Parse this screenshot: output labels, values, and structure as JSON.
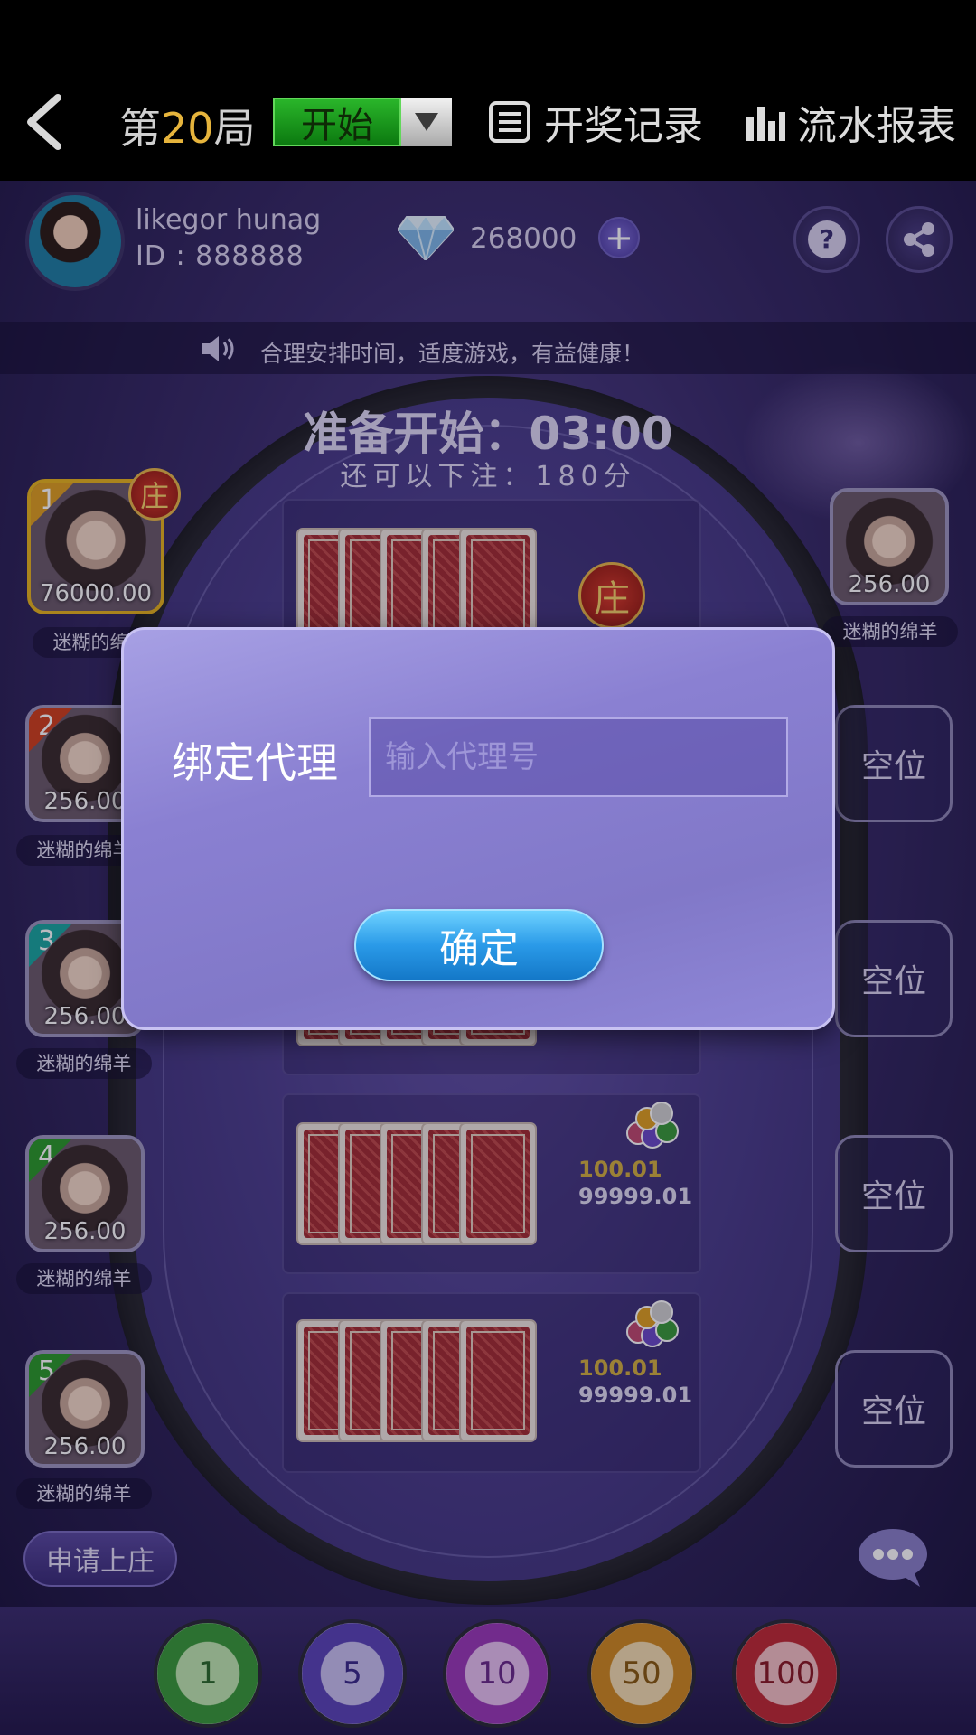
{
  "nav": {
    "round_prefix": "第",
    "round_number": "20",
    "round_suffix": "局",
    "start_label": "开始",
    "records_label": "开奖记录",
    "report_label": "流水报表"
  },
  "user": {
    "name": "likegor hunag",
    "id": "ID : 888888",
    "diamonds": "268000"
  },
  "notice": "合理安排时间，适度游戏，有益健康！",
  "table": {
    "countdown": "准备开始：03:00",
    "bet_remaining": "还可以下注：180分",
    "banker_label": "庄",
    "hands": [
      {
        "bet_a": "100.01",
        "bet_b": "99999.01"
      },
      {
        "bet_a": "100.01",
        "bet_b": "99999.01"
      }
    ]
  },
  "left_seats": [
    {
      "num": "1",
      "score": "76000.00",
      "name": "迷糊的绵羊",
      "color": "#e0a020"
    },
    {
      "num": "2",
      "score": "256.00",
      "name": "迷糊的绵羊",
      "color": "#d0401c"
    },
    {
      "num": "3",
      "score": "256.00",
      "name": "迷糊的绵羊",
      "color": "#1aa7a0"
    },
    {
      "num": "4",
      "score": "256.00",
      "name": "迷糊的绵羊",
      "color": "#2b9a2a"
    },
    {
      "num": "5",
      "score": "256.00",
      "name": "迷糊的绵羊",
      "color": "#2b9a2a"
    }
  ],
  "right_seat": {
    "score": "256.00",
    "name": "迷糊的绵羊"
  },
  "empty_seat_label": "空位",
  "apply_banker": "申请上庄",
  "chips": [
    {
      "value": "1",
      "color": "#3a9a3a"
    },
    {
      "value": "5",
      "color": "#5a44b8"
    },
    {
      "value": "10",
      "color": "#9a3ab8"
    },
    {
      "value": "50",
      "color": "#d08a20"
    },
    {
      "value": "100",
      "color": "#c02a34"
    }
  ],
  "dialog": {
    "label": "绑定代理",
    "placeholder": "输入代理号",
    "confirm": "确定"
  },
  "icons": {
    "back": "chevron-left-icon",
    "caret": "caret-down-icon",
    "records": "list-icon",
    "report": "bar-chart-icon",
    "diamond": "diamond-icon",
    "help": "question-icon",
    "share": "share-icon",
    "speaker": "speaker-icon",
    "chat": "chat-bubble-icon"
  }
}
